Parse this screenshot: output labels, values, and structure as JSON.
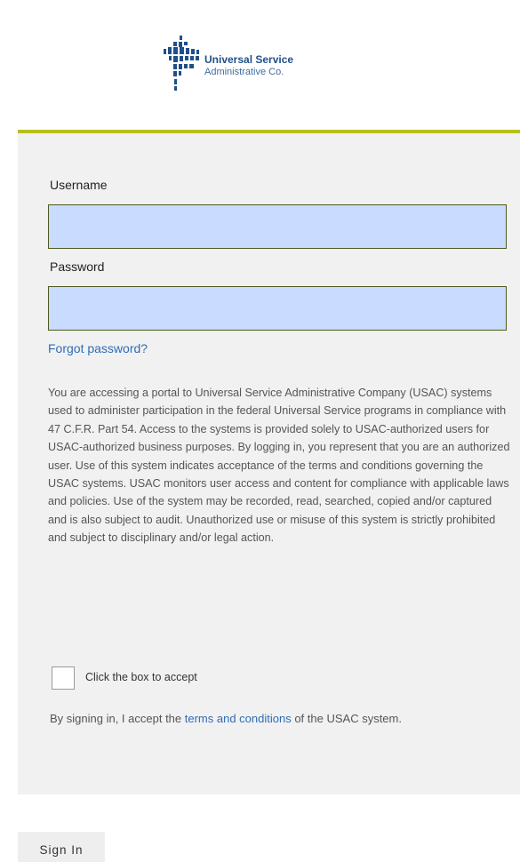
{
  "brand": {
    "line1": "Universal Service",
    "line2": "Administrative Co.",
    "accent_color": "#b9bf1e",
    "logo_color": "#1f4f8a"
  },
  "form": {
    "username_label": "Username",
    "username_value": "",
    "password_label": "Password",
    "password_value": "",
    "forgot_link": "Forgot password?",
    "legal_text": "You are accessing a portal to Universal Service Administrative Company (USAC) systems used to administer participation in the federal Universal Service programs in compliance with 47 C.F.R. Part 54. Access to the systems is provided solely to USAC-authorized users for USAC-authorized business purposes. By logging in, you represent that you are an authorized user. Use of this system indicates acceptance of the terms and conditions governing the USAC systems. USAC monitors user access and content for compliance with applicable laws and policies. Use of the system may be recorded, read, searched, copied and/or captured and is also subject to audit. Unauthorized use or misuse of this system is strictly prohibited and subject to disciplinary and/or legal action.",
    "checkbox_label": "Click the box to accept",
    "accept_prefix": "By signing in, I accept the ",
    "terms_link": "terms and conditions",
    "accept_suffix": " of the USAC system.",
    "input_fill_color": "#c9dcff"
  },
  "actions": {
    "sign_in_label": "Sign In"
  }
}
